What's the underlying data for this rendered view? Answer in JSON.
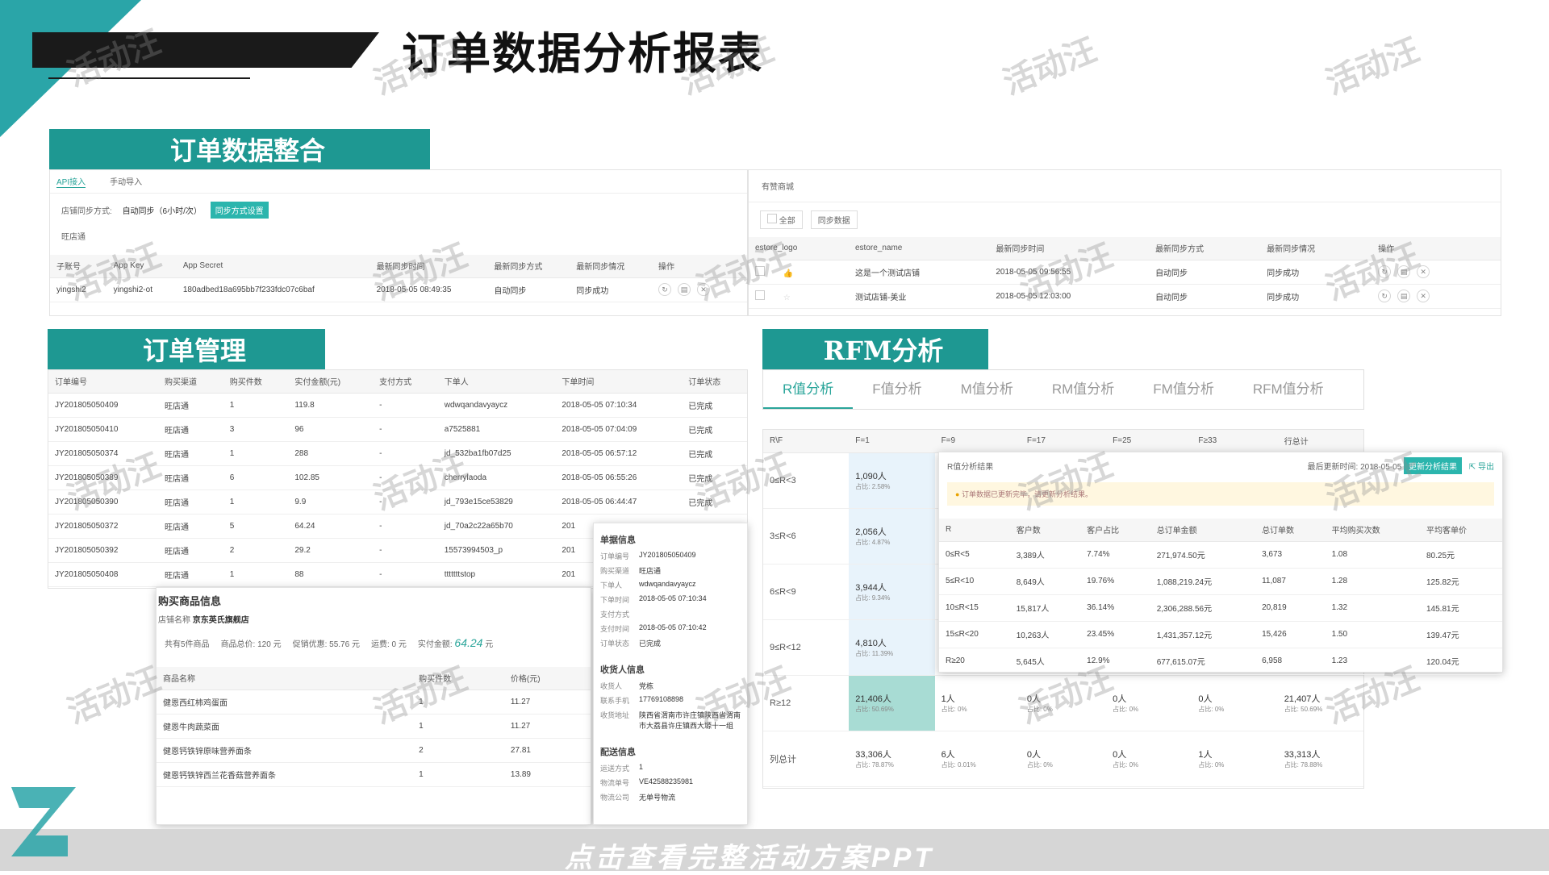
{
  "header": {
    "title": "订单数据分析报表",
    "footer": "点击查看完整活动方案PPT",
    "watermark": "活动汪"
  },
  "sec1": {
    "banner": "订单数据整合",
    "tabs": [
      "API接入",
      "手动导入"
    ],
    "sync_label": "店铺同步方式:",
    "sync_value": "自动同步（6小时/次）",
    "sync_btn": "同步方式设置",
    "shop": "旺店通",
    "cols": [
      "子账号",
      "App Key",
      "App Secret",
      "最新同步时间",
      "最新同步方式",
      "最新同步情况",
      "操作"
    ],
    "row": [
      "yingshi2",
      "yingshi2-ot",
      "180adbed18a695bb7f233fdc07c6baf",
      "2018-05-05 08:49:35",
      "自动同步",
      "同步成功"
    ]
  },
  "sec1b": {
    "title": "有赞商城",
    "all": "全部",
    "sync_btn": "同步数据",
    "cols": [
      "estore_logo",
      "estore_name",
      "最新同步时间",
      "最新同步方式",
      "最新同步情况",
      "操作"
    ],
    "rows": [
      [
        "这是一个测试店铺",
        "2018-05-05 09:56:55",
        "自动同步",
        "同步成功"
      ],
      [
        "测试店铺-美业",
        "2018-05-05 12:03:00",
        "自动同步",
        "同步成功"
      ]
    ]
  },
  "sec2": {
    "banner": "订单管理",
    "cols": [
      "订单编号",
      "购买渠道",
      "购买件数",
      "实付金额(元)",
      "支付方式",
      "下单人",
      "下单时间",
      "订单状态"
    ],
    "rows": [
      [
        "JY201805050409",
        "旺店通",
        "1",
        "119.8",
        "-",
        "wdwqandavyaycz",
        "2018-05-05 07:10:34",
        "已完成"
      ],
      [
        "JY201805050410",
        "旺店通",
        "3",
        "96",
        "-",
        "a7525881",
        "2018-05-05 07:04:09",
        "已完成"
      ],
      [
        "JY201805050374",
        "旺店通",
        "1",
        "288",
        "-",
        "jd_532ba1fb07d25",
        "2018-05-05 06:57:12",
        "已完成"
      ],
      [
        "JY201805050389",
        "旺店通",
        "6",
        "102.85",
        "-",
        "cherrylaoda",
        "2018-05-05 06:55:26",
        "已完成"
      ],
      [
        "JY201805050390",
        "旺店通",
        "1",
        "9.9",
        "-",
        "jd_793e15ce53829",
        "2018-05-05 06:44:47",
        "已完成"
      ],
      [
        "JY201805050372",
        "旺店通",
        "5",
        "64.24",
        "-",
        "jd_70a2c22a65b70",
        "201",
        ""
      ],
      [
        "JY201805050392",
        "旺店通",
        "2",
        "29.2",
        "-",
        "15573994503_p",
        "201",
        ""
      ],
      [
        "JY201805050408",
        "旺店通",
        "1",
        "88",
        "-",
        "tttttttstop",
        "201",
        ""
      ]
    ],
    "goods": {
      "title": "购买商品信息",
      "store_label": "店铺名称",
      "store": "京东英氏旗舰店",
      "summary": [
        "共有5件商品",
        "商品总价: 120 元",
        "促销优惠: 55.76 元",
        "运费: 0 元",
        "实付金额:"
      ],
      "pay": "64.24",
      "unit": "元",
      "cols": [
        "商品名称",
        "购买件数",
        "价格(元)"
      ],
      "rows": [
        [
          "健恩西红柿鸡蛋面",
          "1",
          "11.27"
        ],
        [
          "健恩牛肉蔬菜面",
          "1",
          "11.27"
        ],
        [
          "健恩钙铁锌原味营养面条",
          "2",
          "27.81"
        ],
        [
          "健恩钙铁锌西兰花香菇营养面条",
          "1",
          "13.89"
        ]
      ]
    },
    "detail": {
      "title": "单据信息",
      "items": [
        [
          "订单编号",
          "JY201805050409"
        ],
        [
          "购买渠道",
          "旺店通"
        ],
        [
          "下单人",
          "wdwqandavyaycz"
        ],
        [
          "下单时间",
          "2018-05-05 07:10:34"
        ],
        [
          "支付方式",
          ""
        ],
        [
          "支付时间",
          "2018-05-05 07:10:42"
        ],
        [
          "订单状态",
          "已完成"
        ]
      ],
      "recv_title": "收货人信息",
      "recv": [
        [
          "收货人",
          "党栋"
        ],
        [
          "联系手机",
          "17769108898"
        ],
        [
          "收货地址",
          "陕西省渭南市许庄镇陕西省渭南市大荔县许庄镇西大塬十一组"
        ]
      ],
      "ship_title": "配送信息",
      "ship": [
        [
          "运送方式",
          "1"
        ],
        [
          "物流单号",
          "VE42588235981"
        ],
        [
          "物流公司",
          "无单号物流"
        ]
      ]
    }
  },
  "sec3": {
    "banner": "RFM分析",
    "tabs": [
      "R值分析",
      "F值分析",
      "M值分析",
      "RM值分析",
      "FM值分析",
      "RFM值分析"
    ],
    "cols": [
      "R\\F",
      "F=1",
      "F=9",
      "F=17",
      "F=25",
      "F≥33",
      "行总计"
    ],
    "rows": [
      {
        "label": "0≤R<3",
        "c1": [
          "1,090人",
          "占比: 2.58%"
        ]
      },
      {
        "label": "3≤R<6",
        "c1": [
          "2,056人",
          "占比: 4.87%"
        ]
      },
      {
        "label": "6≤R<9",
        "c1": [
          "3,944人",
          "占比: 9.34%"
        ]
      },
      {
        "label": "9≤R<12",
        "c1": [
          "4,810人",
          "占比: 11.39%"
        ]
      },
      {
        "label": "R≥12",
        "cells": [
          [
            "21,406人",
            "占比: 50.69%"
          ],
          [
            "1人",
            "占比: 0%"
          ],
          [
            "0人",
            "占比: 0%"
          ],
          [
            "0人",
            "占比: 0%"
          ],
          [
            "0人",
            "占比: 0%"
          ],
          [
            "21,407人",
            "占比: 50.69%"
          ]
        ]
      },
      {
        "label": "列总计",
        "cells": [
          [
            "33,306人",
            "占比: 78.87%"
          ],
          [
            "6人",
            "占比: 0.01%"
          ],
          [
            "0人",
            "占比: 0%"
          ],
          [
            "0人",
            "占比: 0%"
          ],
          [
            "1人",
            "占比: 0%"
          ],
          [
            "33,313人",
            "占比: 78.88%"
          ]
        ]
      }
    ],
    "popup": {
      "title": "R值分析结果",
      "updated": "最后更新时间: 2018-05-05",
      "update_btn": "更新分析结果",
      "export": "导出",
      "notice": "订单数据已更新完毕，请更新分析结果。",
      "cols": [
        "R",
        "客户数",
        "客户占比",
        "总订单金额",
        "总订单数",
        "平均购买次数",
        "平均客单价"
      ],
      "rows": [
        [
          "0≤R<5",
          "3,389人",
          "7.74%",
          "271,974.50元",
          "3,673",
          "1.08",
          "80.25元"
        ],
        [
          "5≤R<10",
          "8,649人",
          "19.76%",
          "1,088,219.24元",
          "11,087",
          "1.28",
          "125.82元"
        ],
        [
          "10≤R<15",
          "15,817人",
          "36.14%",
          "2,306,288.56元",
          "20,819",
          "1.32",
          "145.81元"
        ],
        [
          "15≤R<20",
          "10,263人",
          "23.45%",
          "1,431,357.12元",
          "15,426",
          "1.50",
          "139.47元"
        ],
        [
          "R≥20",
          "5,645人",
          "12.9%",
          "677,615.07元",
          "6,958",
          "1.23",
          "120.04元"
        ]
      ]
    }
  },
  "colors": {
    "accent": "#1e9892",
    "link": "#2aa59a",
    "band": "#2aa5a8"
  }
}
